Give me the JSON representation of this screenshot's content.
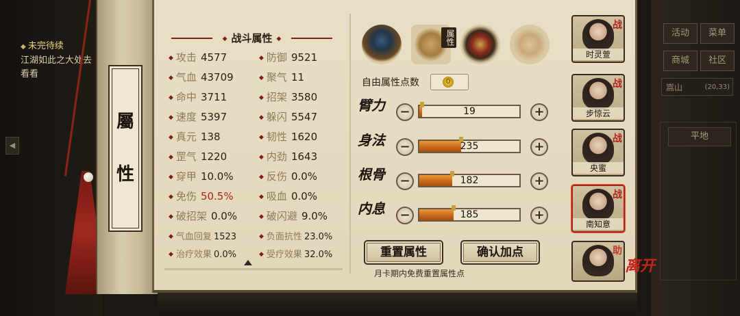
{
  "quest": {
    "title": "未完待续",
    "desc": "江湖如此之大处去看看"
  },
  "hud": {
    "menu": [
      "活动",
      "菜单",
      "商城",
      "社区"
    ],
    "location": "嵩山",
    "coords": "(20,33)",
    "terrain": "平地"
  },
  "scroll": {
    "title_top": "屬",
    "title_bottom": "性"
  },
  "stats": {
    "header": "战斗属性",
    "rows": [
      {
        "k1": "攻击",
        "v1": "4577",
        "k2": "防御",
        "v2": "9521"
      },
      {
        "k1": "气血",
        "v1": "43709",
        "k2": "聚气",
        "v2": "11"
      },
      {
        "k1": "命中",
        "v1": "3711",
        "k2": "招架",
        "v2": "3580"
      },
      {
        "k1": "速度",
        "v1": "5397",
        "k2": "躲闪",
        "v2": "5547"
      },
      {
        "k1": "真元",
        "v1": "138",
        "k2": "韧性",
        "v2": "1620"
      },
      {
        "k1": "罡气",
        "v1": "1220",
        "k2": "内劲",
        "v2": "1643"
      },
      {
        "k1": "穿甲",
        "v1": "10.0%",
        "k2": "反伤",
        "v2": "0.0%"
      },
      {
        "k1": "免伤",
        "v1": "50.5%",
        "k2": "吸血",
        "v2": "0.0%"
      },
      {
        "k1": "破招架",
        "v1": "0.0%",
        "k2": "破闪避",
        "v2": "9.0%"
      },
      {
        "k1": "气血回复",
        "v1": "1523",
        "k2": "负面抗性",
        "v2": "23.0%"
      },
      {
        "k1": "治疗效果",
        "v1": "0.0%",
        "k2": "受疗效果",
        "v2": "32.0%"
      }
    ]
  },
  "tabs": {
    "active_label": "属性"
  },
  "free_points": {
    "label": "自由属性点数",
    "value": "0"
  },
  "attributes": [
    {
      "name": "臂力",
      "value": "19",
      "fill": 0.03
    },
    {
      "name": "身法",
      "value": "235",
      "fill": 0.42
    },
    {
      "name": "根骨",
      "value": "182",
      "fill": 0.33
    },
    {
      "name": "内息",
      "value": "185",
      "fill": 0.34
    }
  ],
  "buttons": {
    "reset": "重置属性",
    "confirm": "确认加点"
  },
  "note": "月卡期内免费重置属性点",
  "team": [
    {
      "name": "时灵萱",
      "tag": "战"
    },
    {
      "name": "步惊云",
      "tag": "战"
    },
    {
      "name": "央蜜",
      "tag": "战"
    },
    {
      "name": "南知意",
      "tag": "战"
    },
    {
      "name": "",
      "tag": "助"
    }
  ],
  "leave": "离开",
  "colors": {
    "accent_red": "#b0231a",
    "bar_orange": "#c6661a",
    "paper": "#e9dfc6"
  }
}
